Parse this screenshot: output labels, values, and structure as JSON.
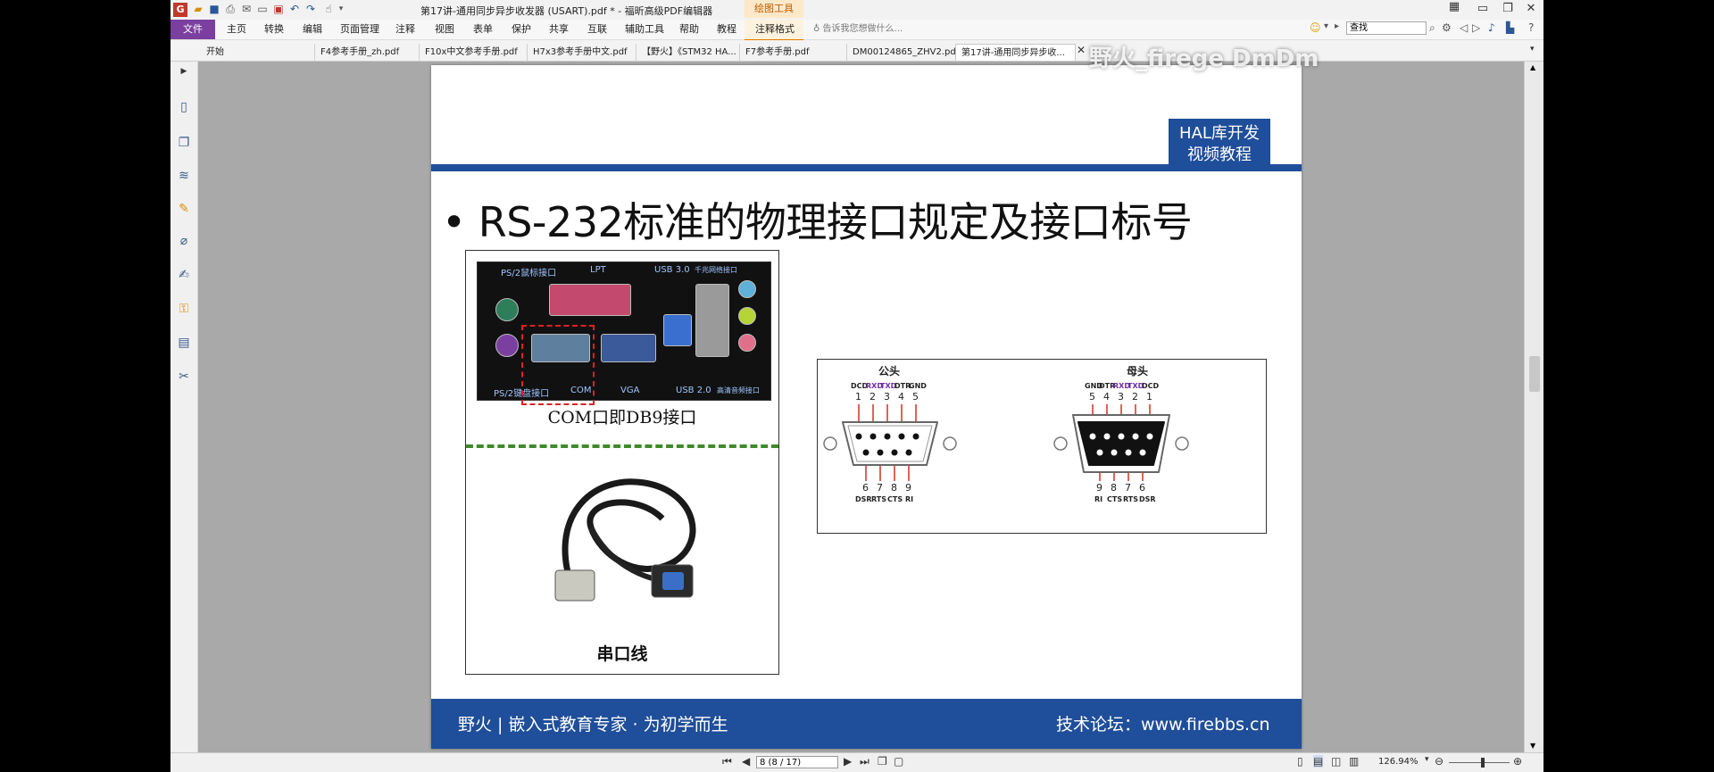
{
  "titlebar": {
    "app_logo": "G",
    "document_title": "第17讲-通用同步异步收发器 (USART).pdf * - 福昕高级PDF编辑器",
    "context_tab": "绘图工具",
    "window_buttons": [
      "minimize-icon",
      "restore-icon",
      "close-icon"
    ]
  },
  "menu": {
    "file": "文件",
    "items": [
      "主页",
      "转换",
      "编辑",
      "页面管理",
      "注释",
      "视图",
      "表单",
      "保护",
      "共享",
      "互联",
      "辅助工具",
      "帮助",
      "教程",
      "注释格式"
    ],
    "tell_me": "告诉我您想做什么...",
    "search_value": "查找"
  },
  "tabs": [
    {
      "label": "开始"
    },
    {
      "label": "F4参考手册_zh.pdf"
    },
    {
      "label": "F10x中文参考手册.pdf"
    },
    {
      "label": "H7x3参考手册中文.pdf"
    },
    {
      "label": "【野火】《STM32 HA..."
    },
    {
      "label": "F7参考手册.pdf"
    },
    {
      "label": "DM00124865_ZHV2.pdf"
    },
    {
      "label": "第17讲-通用同步异步收..."
    }
  ],
  "watermark": "野火_firege  DmDm",
  "slide": {
    "badge_line1": "HAL库开发",
    "badge_line2": "视频教程",
    "heading": "• RS-232标准的物理接口规定及接口标号",
    "board_labels": {
      "ps2_top": "PS/2鼠标接口",
      "lpt": "LPT",
      "usb3": "USB 3.0",
      "lan": "千兆网络接口",
      "ps2_bottom": "PS/2键盘接口",
      "com": "COM",
      "vga": "VGA",
      "usb2": "USB 2.0",
      "audio": "高清音频接口"
    },
    "board_caption": "COM口即DB9接口",
    "cable_caption": "串口线",
    "male": {
      "title": "公头",
      "top_signals": [
        "DCD",
        "RXD",
        "TXD",
        "DTR",
        "GND"
      ],
      "top_pins": [
        "1",
        "2",
        "3",
        "4",
        "5"
      ],
      "bottom_pins": [
        "6",
        "7",
        "8",
        "9"
      ],
      "bottom_signals": [
        "DSR",
        "RTS",
        "CTS",
        "RI"
      ]
    },
    "female": {
      "title": "母头",
      "top_signals": [
        "GND",
        "DTR",
        "RXD",
        "TXD",
        "DCD"
      ],
      "top_pins": [
        "5",
        "4",
        "3",
        "2",
        "1"
      ],
      "bottom_pins": [
        "9",
        "8",
        "7",
        "6"
      ],
      "bottom_signals": [
        "RI",
        "CTS",
        "RTS",
        "DSR"
      ]
    },
    "footer_left": "野火 | 嵌入式教育专家 · 为初学而生",
    "footer_right": "技术论坛：www.firebbs.cn"
  },
  "status": {
    "page_value": "8 (8 / 17)",
    "zoom": "126.94%"
  },
  "colors": {
    "accent_blue": "#1f4e9a",
    "file_menu": "#7b3fa0",
    "signal_purple": "#7030a0",
    "com_highlight": "#e02020",
    "divider_green": "#3f8a2a"
  }
}
